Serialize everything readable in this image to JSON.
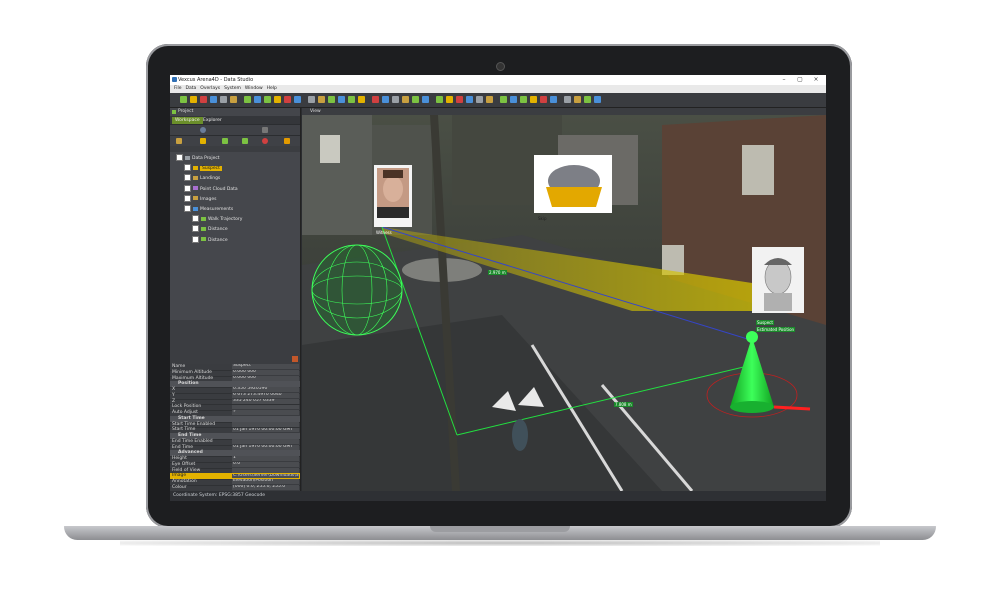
{
  "window": {
    "title": "Vexcus Arena4D - Data Studio",
    "min_label": "–",
    "max_label": "▢",
    "close_label": "×"
  },
  "menu": [
    "File",
    "Data",
    "Overlays",
    "System",
    "Window",
    "Help"
  ],
  "project_panel": {
    "title": "Project",
    "tabs": [
      "Workspace",
      "Explorer"
    ],
    "tree": [
      {
        "label": "Data Project",
        "indent": 0,
        "icon_color": "#9aa0a6",
        "highlight": false
      },
      {
        "label": "Suspect",
        "indent": 1,
        "icon_color": "#e3b200",
        "highlight": true
      },
      {
        "label": "Landings",
        "indent": 1,
        "icon_color": "#c8a040",
        "highlight": false
      },
      {
        "label": "Point Cloud Data",
        "indent": 1,
        "icon_color": "#a86fd0",
        "highlight": false
      },
      {
        "label": "Images",
        "indent": 1,
        "icon_color": "#c8a040",
        "highlight": false
      },
      {
        "label": "Measurements",
        "indent": 1,
        "icon_color": "#4a90d9",
        "highlight": false
      },
      {
        "label": "Walk Trajectory",
        "indent": 2,
        "icon_color": "#7cc242",
        "highlight": false
      },
      {
        "label": "Distance",
        "indent": 2,
        "icon_color": "#7cc242",
        "highlight": false
      },
      {
        "label": "Distance",
        "indent": 2,
        "icon_color": "#7cc242",
        "highlight": false
      }
    ]
  },
  "properties": [
    {
      "key": "Name",
      "value": "Suspect",
      "type": "row"
    },
    {
      "key": "Minimum Altitude",
      "value": "0.000 000",
      "type": "row"
    },
    {
      "key": "Maximum Altitude",
      "value": "0.000 000",
      "type": "row"
    },
    {
      "key": "Position",
      "value": "",
      "type": "section"
    },
    {
      "key": "X",
      "value": "0.350 5920590",
      "type": "row"
    },
    {
      "key": "Y",
      "value": "6 673 273.4970 0040",
      "type": "row"
    },
    {
      "key": "Z",
      "value": "335 240 057 6339",
      "type": "row"
    },
    {
      "key": "Lock Position",
      "value": "",
      "type": "row"
    },
    {
      "key": "Auto Adjust",
      "value": "✓",
      "type": "row"
    },
    {
      "key": "Start Time",
      "value": "",
      "type": "section"
    },
    {
      "key": "Start Time Enabled",
      "value": "",
      "type": "row"
    },
    {
      "key": "Start Time",
      "value": "01 Jan 1970 00:00:00 GMT",
      "type": "row"
    },
    {
      "key": "End Time",
      "value": "",
      "type": "section"
    },
    {
      "key": "End Time Enabled",
      "value": "",
      "type": "row"
    },
    {
      "key": "End Time",
      "value": "01 Jan 1970 00:00:00 GMT",
      "type": "row"
    },
    {
      "key": "Advanced",
      "value": "",
      "type": "section"
    },
    {
      "key": "Height",
      "value": "1",
      "type": "row"
    },
    {
      "key": "Eye Offset",
      "value": "0.0",
      "type": "row"
    },
    {
      "key": "Field of View",
      "value": "",
      "type": "row"
    },
    {
      "key": "Image",
      "value": "C:\\Users\\Server\\Downloads\\Susp",
      "type": "selected"
    },
    {
      "key": "Annotation",
      "value": "Elevation/Position",
      "type": "row"
    },
    {
      "key": "Colour",
      "value": "[000] 0.0, 255.0, 255.0",
      "type": "row"
    }
  ],
  "view": {
    "title": "View",
    "labels": {
      "witness": "Witness",
      "skip": "Skip",
      "suspect": "Suspect",
      "suspect_sub": "Estimated Position",
      "dist1": "2.970 m",
      "dist2": "7.808 m"
    }
  },
  "status": {
    "text": "Coordinate System: EPSG:3857 Geocode"
  },
  "colors": {
    "accent": "#7cc242",
    "highlight": "#e3b200",
    "beam": "#d4c200",
    "marker": "#22e040"
  }
}
